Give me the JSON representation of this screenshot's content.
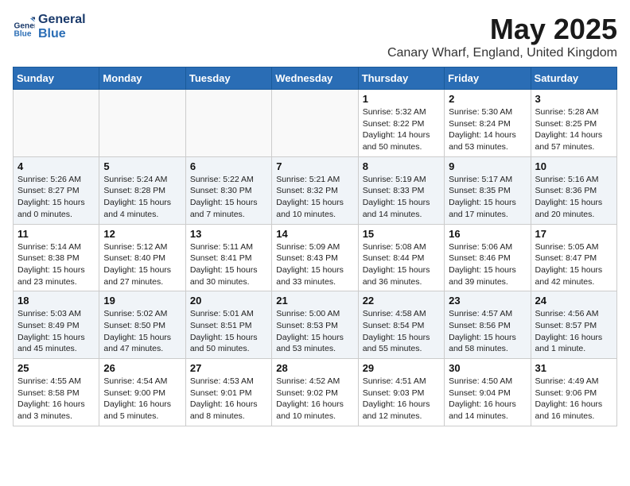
{
  "logo": {
    "line1": "General",
    "line2": "Blue"
  },
  "title": "May 2025",
  "subtitle": "Canary Wharf, England, United Kingdom",
  "days_header": [
    "Sunday",
    "Monday",
    "Tuesday",
    "Wednesday",
    "Thursday",
    "Friday",
    "Saturday"
  ],
  "weeks": [
    [
      {
        "day": "",
        "info": ""
      },
      {
        "day": "",
        "info": ""
      },
      {
        "day": "",
        "info": ""
      },
      {
        "day": "",
        "info": ""
      },
      {
        "day": "1",
        "info": "Sunrise: 5:32 AM\nSunset: 8:22 PM\nDaylight: 14 hours\nand 50 minutes."
      },
      {
        "day": "2",
        "info": "Sunrise: 5:30 AM\nSunset: 8:24 PM\nDaylight: 14 hours\nand 53 minutes."
      },
      {
        "day": "3",
        "info": "Sunrise: 5:28 AM\nSunset: 8:25 PM\nDaylight: 14 hours\nand 57 minutes."
      }
    ],
    [
      {
        "day": "4",
        "info": "Sunrise: 5:26 AM\nSunset: 8:27 PM\nDaylight: 15 hours\nand 0 minutes."
      },
      {
        "day": "5",
        "info": "Sunrise: 5:24 AM\nSunset: 8:28 PM\nDaylight: 15 hours\nand 4 minutes."
      },
      {
        "day": "6",
        "info": "Sunrise: 5:22 AM\nSunset: 8:30 PM\nDaylight: 15 hours\nand 7 minutes."
      },
      {
        "day": "7",
        "info": "Sunrise: 5:21 AM\nSunset: 8:32 PM\nDaylight: 15 hours\nand 10 minutes."
      },
      {
        "day": "8",
        "info": "Sunrise: 5:19 AM\nSunset: 8:33 PM\nDaylight: 15 hours\nand 14 minutes."
      },
      {
        "day": "9",
        "info": "Sunrise: 5:17 AM\nSunset: 8:35 PM\nDaylight: 15 hours\nand 17 minutes."
      },
      {
        "day": "10",
        "info": "Sunrise: 5:16 AM\nSunset: 8:36 PM\nDaylight: 15 hours\nand 20 minutes."
      }
    ],
    [
      {
        "day": "11",
        "info": "Sunrise: 5:14 AM\nSunset: 8:38 PM\nDaylight: 15 hours\nand 23 minutes."
      },
      {
        "day": "12",
        "info": "Sunrise: 5:12 AM\nSunset: 8:40 PM\nDaylight: 15 hours\nand 27 minutes."
      },
      {
        "day": "13",
        "info": "Sunrise: 5:11 AM\nSunset: 8:41 PM\nDaylight: 15 hours\nand 30 minutes."
      },
      {
        "day": "14",
        "info": "Sunrise: 5:09 AM\nSunset: 8:43 PM\nDaylight: 15 hours\nand 33 minutes."
      },
      {
        "day": "15",
        "info": "Sunrise: 5:08 AM\nSunset: 8:44 PM\nDaylight: 15 hours\nand 36 minutes."
      },
      {
        "day": "16",
        "info": "Sunrise: 5:06 AM\nSunset: 8:46 PM\nDaylight: 15 hours\nand 39 minutes."
      },
      {
        "day": "17",
        "info": "Sunrise: 5:05 AM\nSunset: 8:47 PM\nDaylight: 15 hours\nand 42 minutes."
      }
    ],
    [
      {
        "day": "18",
        "info": "Sunrise: 5:03 AM\nSunset: 8:49 PM\nDaylight: 15 hours\nand 45 minutes."
      },
      {
        "day": "19",
        "info": "Sunrise: 5:02 AM\nSunset: 8:50 PM\nDaylight: 15 hours\nand 47 minutes."
      },
      {
        "day": "20",
        "info": "Sunrise: 5:01 AM\nSunset: 8:51 PM\nDaylight: 15 hours\nand 50 minutes."
      },
      {
        "day": "21",
        "info": "Sunrise: 5:00 AM\nSunset: 8:53 PM\nDaylight: 15 hours\nand 53 minutes."
      },
      {
        "day": "22",
        "info": "Sunrise: 4:58 AM\nSunset: 8:54 PM\nDaylight: 15 hours\nand 55 minutes."
      },
      {
        "day": "23",
        "info": "Sunrise: 4:57 AM\nSunset: 8:56 PM\nDaylight: 15 hours\nand 58 minutes."
      },
      {
        "day": "24",
        "info": "Sunrise: 4:56 AM\nSunset: 8:57 PM\nDaylight: 16 hours\nand 1 minute."
      }
    ],
    [
      {
        "day": "25",
        "info": "Sunrise: 4:55 AM\nSunset: 8:58 PM\nDaylight: 16 hours\nand 3 minutes."
      },
      {
        "day": "26",
        "info": "Sunrise: 4:54 AM\nSunset: 9:00 PM\nDaylight: 16 hours\nand 5 minutes."
      },
      {
        "day": "27",
        "info": "Sunrise: 4:53 AM\nSunset: 9:01 PM\nDaylight: 16 hours\nand 8 minutes."
      },
      {
        "day": "28",
        "info": "Sunrise: 4:52 AM\nSunset: 9:02 PM\nDaylight: 16 hours\nand 10 minutes."
      },
      {
        "day": "29",
        "info": "Sunrise: 4:51 AM\nSunset: 9:03 PM\nDaylight: 16 hours\nand 12 minutes."
      },
      {
        "day": "30",
        "info": "Sunrise: 4:50 AM\nSunset: 9:04 PM\nDaylight: 16 hours\nand 14 minutes."
      },
      {
        "day": "31",
        "info": "Sunrise: 4:49 AM\nSunset: 9:06 PM\nDaylight: 16 hours\nand 16 minutes."
      }
    ]
  ]
}
